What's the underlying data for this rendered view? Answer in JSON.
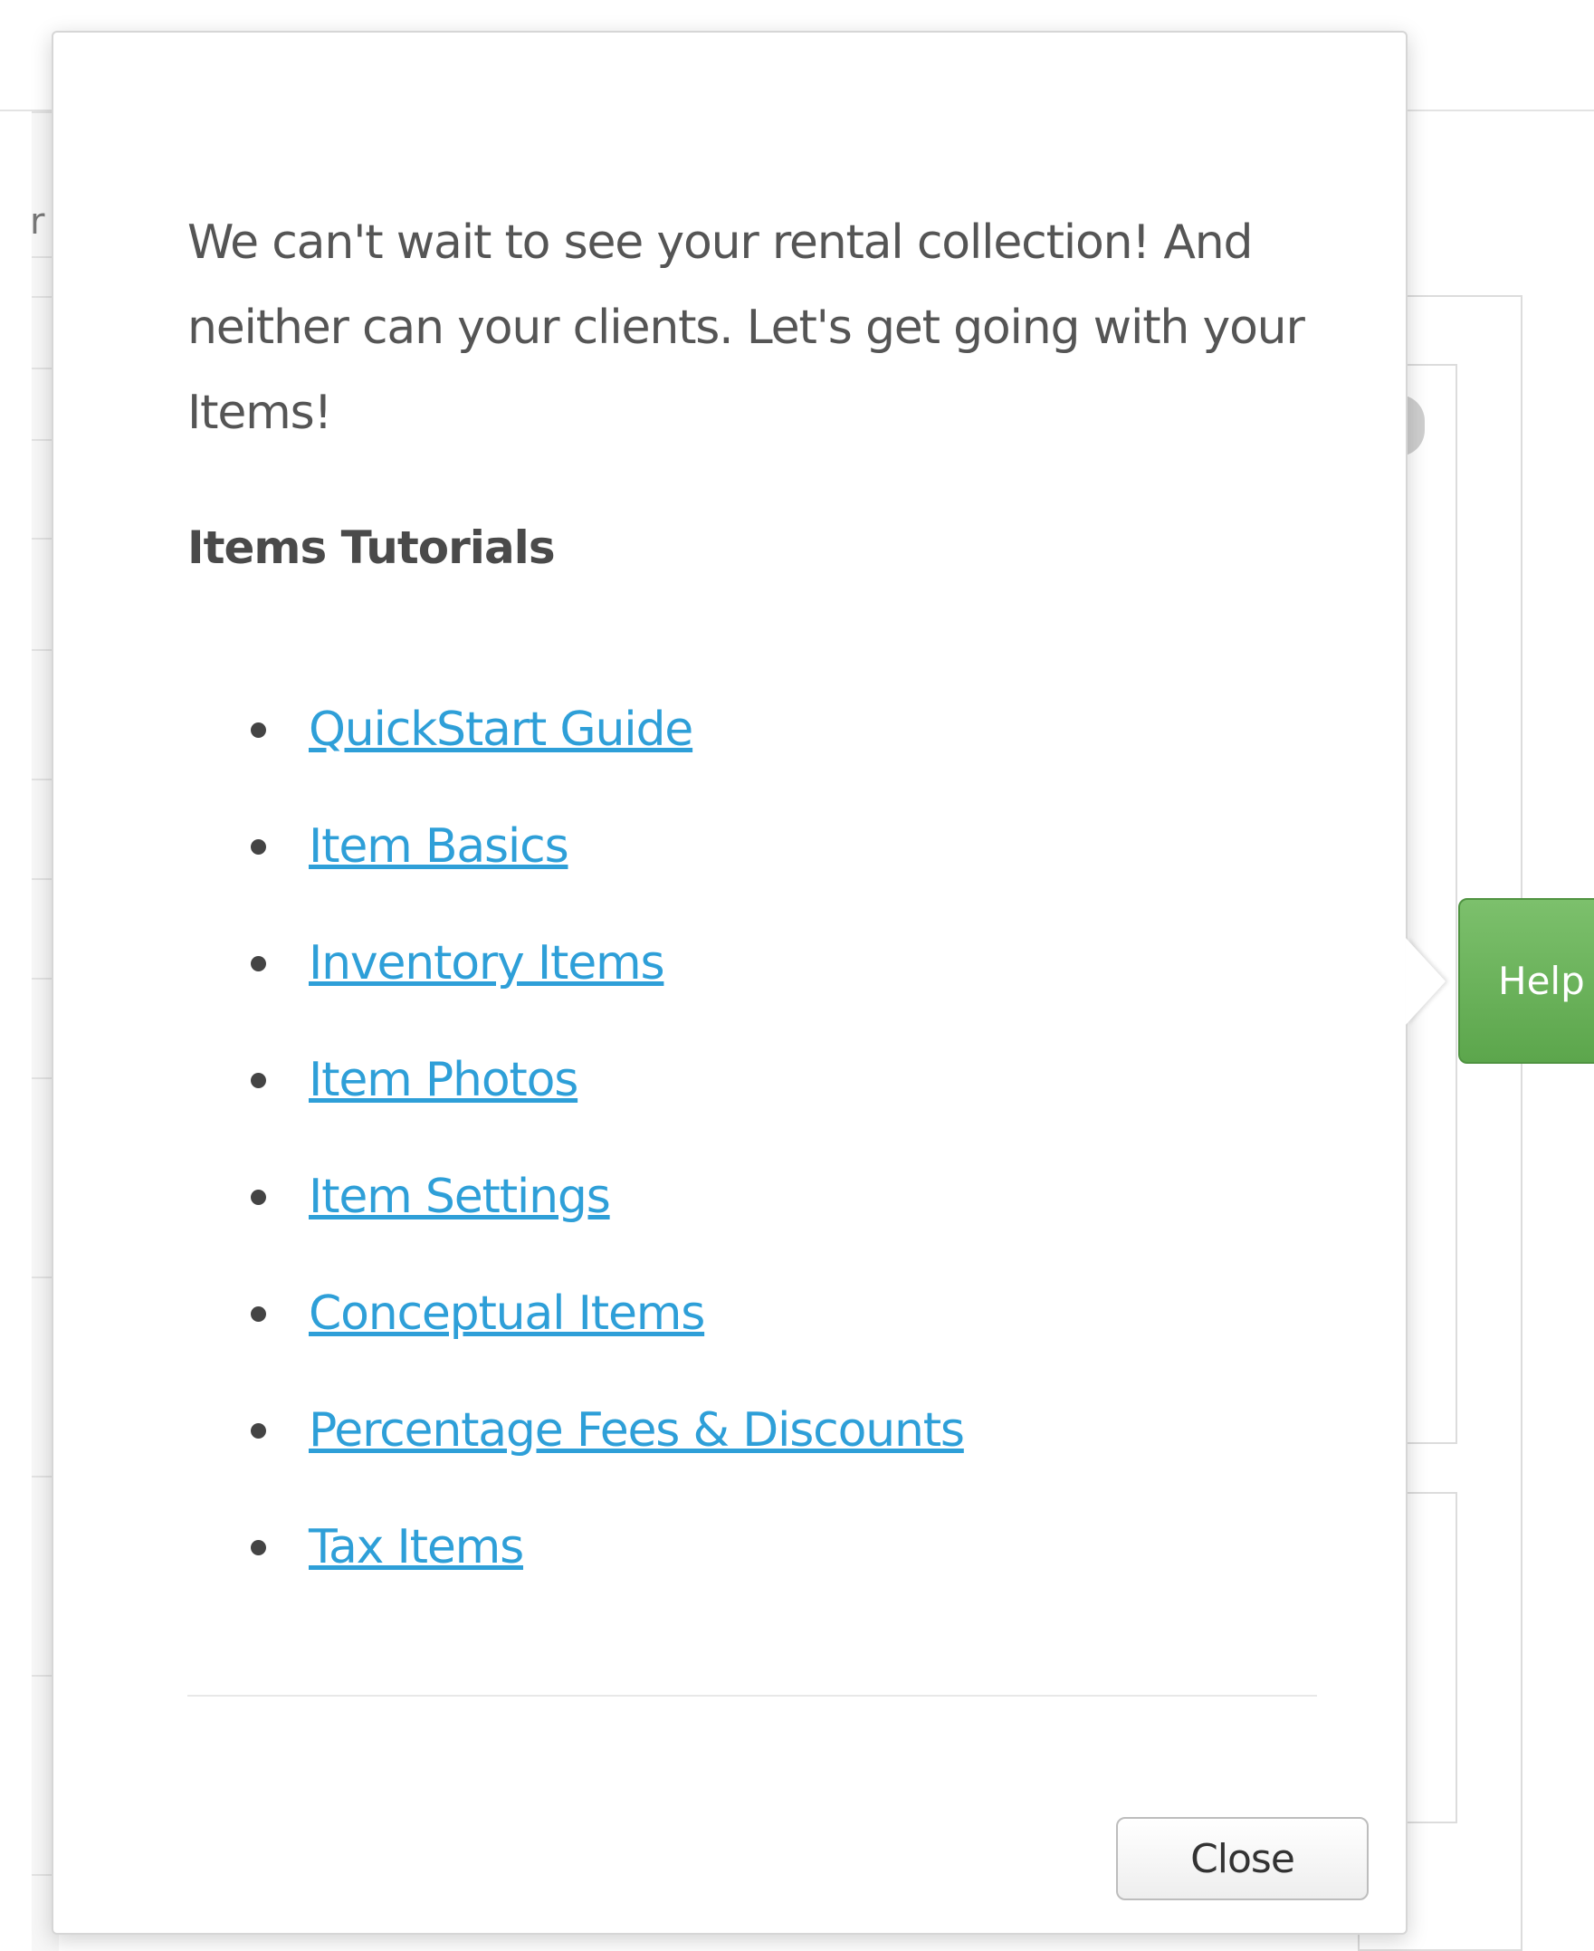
{
  "popover": {
    "intro_text": "We can't wait to see your rental collection! And neither can your clients. Let's get going with your Items!",
    "section_title": "Items Tutorials",
    "tutorials": [
      {
        "label": "QuickStart Guide"
      },
      {
        "label": "Item Basics"
      },
      {
        "label": "Inventory Items"
      },
      {
        "label": "Item Photos"
      },
      {
        "label": "Item Settings"
      },
      {
        "label": "Conceptual Items"
      },
      {
        "label": "Percentage Fees & Discounts"
      },
      {
        "label": "Tax Items"
      }
    ],
    "close_label": "Close"
  },
  "help_tab": {
    "label": "Help"
  },
  "background": {
    "left_char": "r"
  },
  "colors": {
    "link": "#2e9fd8",
    "help_green": "#6bb35b",
    "body_text": "#555555"
  }
}
